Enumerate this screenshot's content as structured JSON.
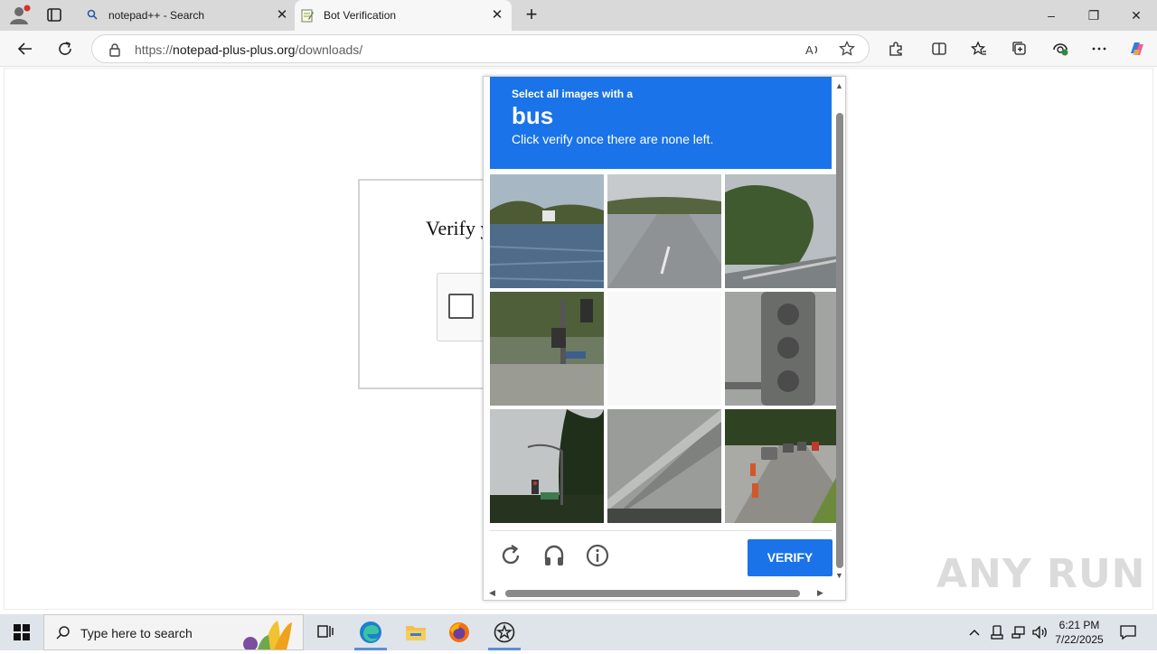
{
  "browser": {
    "tabs": [
      {
        "title": "notepad++ - Search",
        "icon": "search-icon",
        "active": false
      },
      {
        "title": "Bot Verification",
        "icon": "notepad-favicon",
        "active": true
      }
    ],
    "address": {
      "prefix": "https://",
      "host": "notepad-plus-plus.org",
      "path": "/downloads/"
    },
    "window_controls": {
      "minimize": "–",
      "restore": "❐",
      "close": "✕"
    }
  },
  "page": {
    "verify_title": "Verify you are human"
  },
  "challenge": {
    "instruction_small": "Select all images with a",
    "target_word": "bus",
    "instruction_sub": "Click verify once there are none left.",
    "verify_label": "VERIFY",
    "accent_color": "#1a73e8",
    "tiles": [
      {
        "scene": "lake-shore"
      },
      {
        "scene": "highway"
      },
      {
        "scene": "roadside-trees"
      },
      {
        "scene": "traffic-signal-pole"
      },
      {
        "scene": "blank"
      },
      {
        "scene": "traffic-light-closeup"
      },
      {
        "scene": "street-light-trees"
      },
      {
        "scene": "highway-barrier"
      },
      {
        "scene": "road-traffic-cones"
      }
    ]
  },
  "watermark": "ANY RUN",
  "taskbar": {
    "search_placeholder": "Type here to search",
    "time": "6:21 PM",
    "date": "7/22/2025"
  }
}
